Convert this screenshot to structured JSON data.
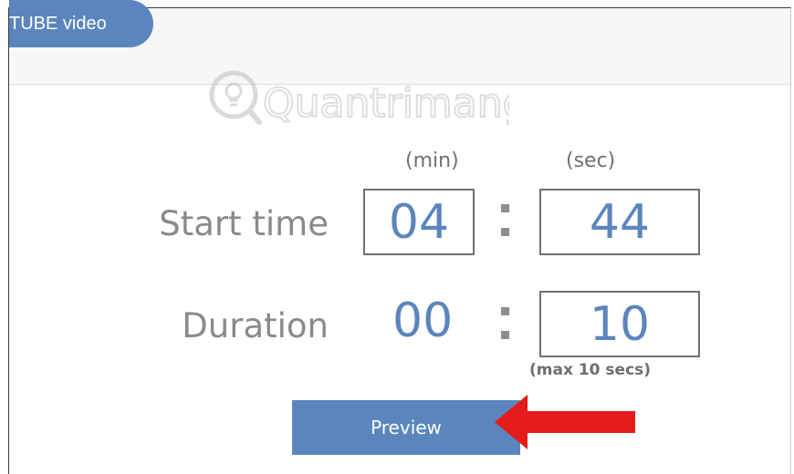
{
  "tab": {
    "label": "TUBE video"
  },
  "watermark": {
    "text": "Quantrimang"
  },
  "units": {
    "min": "(min)",
    "sec": "(sec)"
  },
  "start_time": {
    "label": "Start time",
    "min": "04",
    "sec": "44"
  },
  "duration": {
    "label": "Duration",
    "min": "00",
    "sec": "10",
    "hint": "(max 10 secs)"
  },
  "preview": {
    "label": "Preview"
  },
  "colors": {
    "accent": "#5b86bd",
    "arrow": "#e51c1c",
    "label": "#8a8a8a"
  }
}
